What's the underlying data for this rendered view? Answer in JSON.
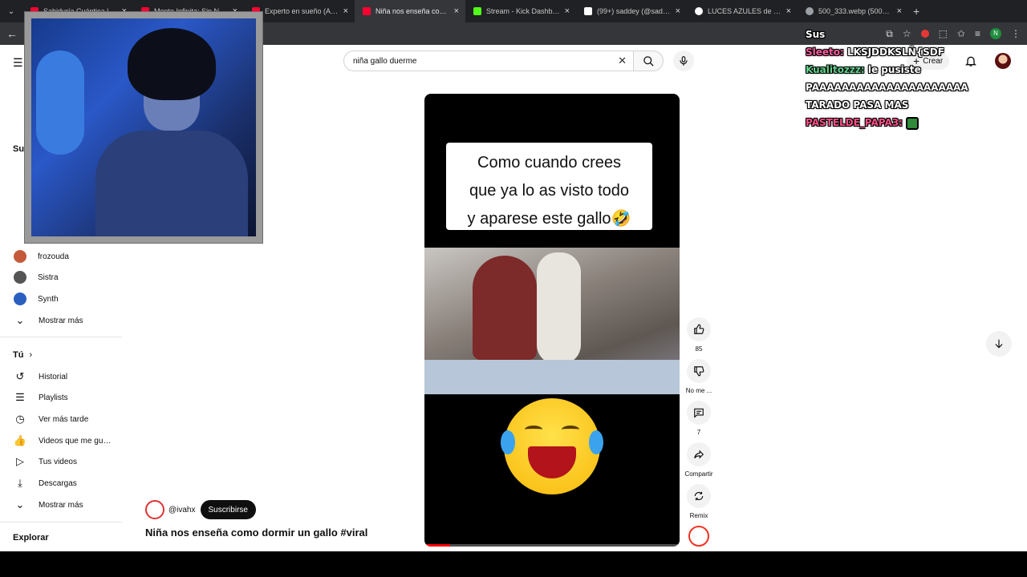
{
  "browser": {
    "tabs": [
      {
        "title": "Sabiduría Cuántica | Vid...",
        "color": "#ff0033",
        "active": false
      },
      {
        "title": "Mente Infinita: Sin Nombre",
        "color": "#ff0033",
        "active": false
      },
      {
        "title": "Experto en sueño (Andalu...",
        "color": "#ff0033",
        "active": false
      },
      {
        "title": "Niña nos enseña como d...",
        "color": "#ff0033",
        "active": true
      },
      {
        "title": "Stream - Kick Dashboard",
        "color": "#53fc18",
        "active": false
      },
      {
        "title": "(99+) saddey (@saddeysith...",
        "color": "#ffffff",
        "active": false
      },
      {
        "title": "LUCES AZULES de pantall...",
        "color": "#ffffff",
        "active": false
      },
      {
        "title": "500_333.webp (500×333)",
        "color": "#9aa0a6",
        "active": false
      }
    ],
    "profile_initial": "N"
  },
  "youtube": {
    "search": {
      "query": "niña gallo duerme"
    },
    "create_label": "Crear",
    "sidebar": {
      "subs_heading": "Su",
      "subscriptions": [
        {
          "label": "frozouda",
          "color": "#c45a3a"
        },
        {
          "label": "Sistra",
          "color": "#555555"
        },
        {
          "label": "Synth",
          "color": "#2b5fbf"
        }
      ],
      "show_more_1": "Mostrar más",
      "you_heading": "Tú",
      "you_items": [
        {
          "label": "Historial",
          "icon": "history-icon"
        },
        {
          "label": "Playlists",
          "icon": "playlists-icon"
        },
        {
          "label": "Ver más tarde",
          "icon": "clock-icon"
        },
        {
          "label": "Videos que me gust...",
          "icon": "thumbs-up-icon"
        },
        {
          "label": "Tus videos",
          "icon": "video-icon"
        },
        {
          "label": "Descargas",
          "icon": "download-icon"
        }
      ],
      "show_more_2": "Mostrar más",
      "explore_heading": "Explorar"
    },
    "video": {
      "caption_lines": [
        "Como cuando crees",
        "que ya lo as visto todo",
        "y aparese este gallo🤣"
      ],
      "channel_handle": "@ivahx",
      "subscribe_label": "Suscribirse",
      "title": "Niña nos enseña como dormir un gallo #viral",
      "progress_fraction": 0.1
    },
    "actions": {
      "like_count": "85",
      "dislike_label": "No me ...",
      "comments_count": "7",
      "share_label": "Compartir",
      "remix_label": "Remix"
    }
  },
  "stream_overlay": {
    "chat": [
      {
        "user": "Sus",
        "message": ""
      },
      {
        "user": "Sleeto:",
        "message": "LKSJDDKSLÑ{SDF"
      },
      {
        "user": "Kualitozzz:",
        "message": "le pusiste"
      },
      {
        "user": "",
        "message": "PAAAAAAAAAAAAAAAAAAAAA"
      },
      {
        "user": "",
        "message": "TARADO PASA MAS"
      },
      {
        "user": "PASTELDE_PAPA3:",
        "message": ""
      }
    ]
  }
}
